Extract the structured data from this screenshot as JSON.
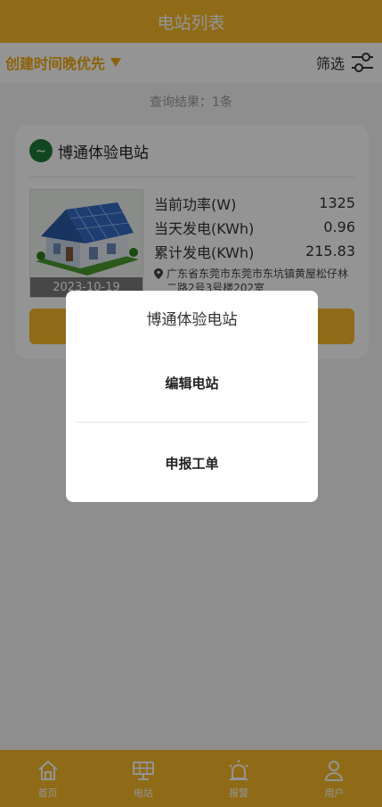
{
  "header": {
    "title": "电站列表"
  },
  "toolbar": {
    "sort_label": "创建时间晚优先",
    "filter_label": "筛选"
  },
  "result_text": "查询结果：1条",
  "station": {
    "name": "博通体验电站",
    "logo_glyph": "~",
    "date": "2023-10-19",
    "stats": [
      {
        "label": "当前功率(W)",
        "value": "1325"
      },
      {
        "label": "当天发电(KWh)",
        "value": "0.96"
      },
      {
        "label": "累计发电(KWh)",
        "value": "215.83"
      }
    ],
    "address": "广东省东莞市东莞市东坑镇黄屋松仔林二路2号3号楼202室"
  },
  "dialog": {
    "title": "博通体验电站",
    "options": [
      "编辑电站",
      "申报工单"
    ]
  },
  "tabbar": {
    "items": [
      {
        "label": "首页",
        "icon": "home-icon"
      },
      {
        "label": "电站",
        "icon": "solar-panel-icon"
      },
      {
        "label": "报警",
        "icon": "alarm-icon"
      },
      {
        "label": "用户",
        "icon": "user-icon"
      }
    ]
  },
  "colors": {
    "brand": "#f6b928",
    "sort_accent": "#f2aa10",
    "logo_green": "#1e7a37"
  }
}
